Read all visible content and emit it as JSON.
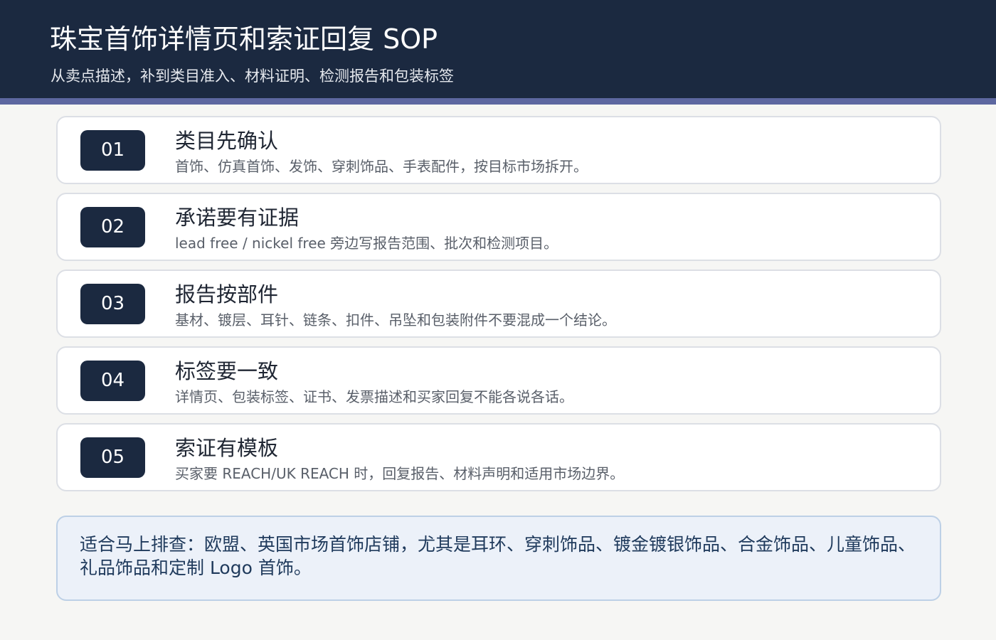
{
  "header": {
    "title": "珠宝首饰详情页和索证回复 SOP",
    "subtitle": "从卖点描述，补到类目准入、材料证明、检测报告和包装标签"
  },
  "steps": [
    {
      "number": "01",
      "title": "类目先确认",
      "description": "首饰、仿真首饰、发饰、穿刺饰品、手表配件，按目标市场拆开。"
    },
    {
      "number": "02",
      "title": "承诺要有证据",
      "description": "lead free / nickel free 旁边写报告范围、批次和检测项目。"
    },
    {
      "number": "03",
      "title": "报告按部件",
      "description": "基材、镀层、耳针、链条、扣件、吊坠和包装附件不要混成一个结论。"
    },
    {
      "number": "04",
      "title": "标签要一致",
      "description": "详情页、包装标签、证书、发票描述和买家回复不能各说各话。"
    },
    {
      "number": "05",
      "title": "索证有模板",
      "description": "买家要 REACH/UK REACH 时，回复报告、材料声明和适用市场边界。"
    }
  ],
  "note": {
    "text": "适合马上排查：欧盟、英国市场首饰店铺，尤其是耳环、穿刺饰品、镀金镀银饰品、合金饰品、儿童饰品、礼品饰品和定制 Logo 首饰。"
  },
  "colors": {
    "header_bg": "#1b2940",
    "accent_stripe": "#5d67a0",
    "badge_bg": "#1b2940",
    "note_bg": "#ecf1f9",
    "note_border": "#bdd0e6",
    "note_text": "#1f3a5c"
  }
}
